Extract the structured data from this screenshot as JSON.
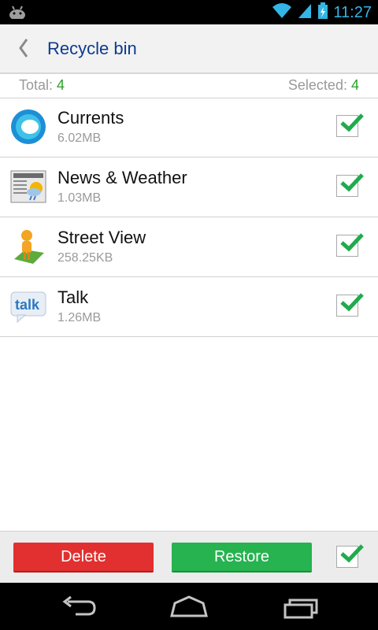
{
  "status": {
    "time": "11:27"
  },
  "header": {
    "title": "Recycle bin"
  },
  "summary": {
    "total_label": "Total:",
    "total": "4",
    "selected_label": "Selected:",
    "selected": "4"
  },
  "apps": [
    {
      "name": "Currents",
      "size": "6.02MB",
      "icon": "currents-icon",
      "checked": true
    },
    {
      "name": "News & Weather",
      "size": "1.03MB",
      "icon": "news-weather-icon",
      "checked": true
    },
    {
      "name": "Street View",
      "size": "258.25KB",
      "icon": "street-view-icon",
      "checked": true
    },
    {
      "name": "Talk",
      "size": "1.26MB",
      "icon": "talk-icon",
      "checked": true
    }
  ],
  "actions": {
    "delete_label": "Delete",
    "restore_label": "Restore"
  },
  "colors": {
    "delete": "#e22f2f",
    "restore": "#26b350",
    "accent_text": "#0d3b8e",
    "check": "#1fab4d"
  }
}
